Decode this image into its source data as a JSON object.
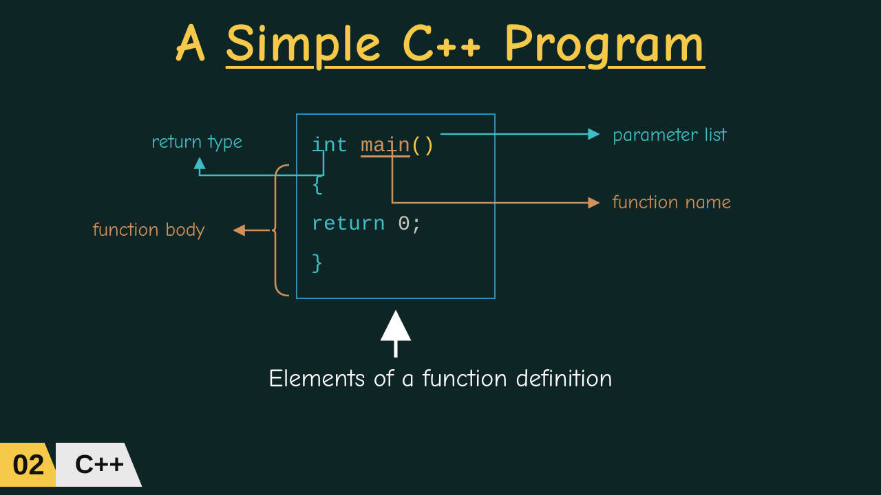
{
  "title_prefix": "A",
  "title_underlined": "Simple C++ Program",
  "code": {
    "return_type": "int",
    "func_name": "main",
    "paren_open": "(",
    "paren_close": ")",
    "brace_open": "{",
    "return_kw": "return",
    "return_val": "0",
    "semicolon": ";",
    "brace_close": "}"
  },
  "labels": {
    "return_type": "return type",
    "parameter_list": "parameter list",
    "function_name": "function name",
    "function_body": "function body"
  },
  "caption": "Elements of a function definition",
  "badge": {
    "number": "02",
    "language": "C++"
  },
  "colors": {
    "bg": "#0e2525",
    "accent_yellow": "#f7c948",
    "teal": "#3fbcc4",
    "orange": "#d0915c",
    "box_border": "#2b8fb8"
  }
}
